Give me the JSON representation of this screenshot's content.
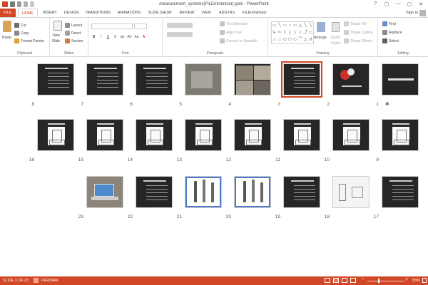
{
  "window": {
    "title": "measurement_systems(FILEminimizer).pptx - PowerPoint",
    "controls": [
      "?",
      "▢",
      "—",
      "▢",
      "✕"
    ]
  },
  "account": {
    "sign_in": "Sign in"
  },
  "tabs": [
    {
      "id": "file",
      "label": "FILE"
    },
    {
      "id": "home",
      "label": "HOME"
    },
    {
      "id": "insert",
      "label": "INSERT"
    },
    {
      "id": "design",
      "label": "DESIGN"
    },
    {
      "id": "transitions",
      "label": "TRANSITIONS"
    },
    {
      "id": "animations",
      "label": "ANIMATIONS"
    },
    {
      "id": "slideshow",
      "label": "SLIDE SHOW"
    },
    {
      "id": "review",
      "label": "REVIEW"
    },
    {
      "id": "view",
      "label": "VIEW"
    },
    {
      "id": "addins",
      "label": "ADD-INS"
    },
    {
      "id": "fileminimizer",
      "label": "FILEminimizer"
    }
  ],
  "ribbon": {
    "clipboard": {
      "label": "Clipboard",
      "paste": "Paste",
      "cut": "Cut",
      "copy": "Copy",
      "format_painter": "Format Painter"
    },
    "slides": {
      "label": "Slides",
      "new_slide": "New",
      "new_slide_2": "Slide",
      "layout": "Layout",
      "reset": "Reset",
      "section": "Section"
    },
    "font": {
      "label": "Font",
      "buttons": [
        "B",
        "I",
        "U",
        "S",
        "ab",
        "AV",
        "Aa",
        "A"
      ]
    },
    "paragraph": {
      "label": "Paragraph",
      "text_direction": "Text Direction",
      "align_text": "Align Text",
      "convert_smartart": "Convert to SmartArt"
    },
    "drawing": {
      "label": "Drawing",
      "arrange": "Arrange",
      "quick_styles": "Quick",
      "quick_styles_2": "Styles",
      "shape_fill": "Shape Fill",
      "shape_outline": "Shape Outline",
      "shape_effects": "Shape Effects"
    },
    "editing": {
      "label": "Editing",
      "find": "Find",
      "replace": "Replace",
      "select": "Select"
    }
  },
  "shapes": [
    "▭",
    "╲",
    "▭",
    "○",
    "▭",
    "△",
    "╲",
    "╲",
    "↳",
    "⇨",
    "⇧",
    "{",
    "}",
    "☆",
    "⤴",
    "▭",
    "▱",
    "⌂",
    "⬭",
    "⬠",
    "◇",
    "⌒",
    "△",
    "↺"
  ],
  "slides": [
    {
      "num": "1",
      "style": "title-dark"
    },
    {
      "num": "2",
      "style": "photo-flowers"
    },
    {
      "num": "3",
      "style": "text-dark",
      "selected": true
    },
    {
      "num": "4",
      "style": "photo-grid"
    },
    {
      "num": "5",
      "style": "photo-machine"
    },
    {
      "num": "6",
      "style": "text-dark"
    },
    {
      "num": "7",
      "style": "text-dark"
    },
    {
      "num": "8",
      "style": "text-dark"
    },
    {
      "num": "9",
      "style": "diagram"
    },
    {
      "num": "10",
      "style": "diagram"
    },
    {
      "num": "11",
      "style": "diagram"
    },
    {
      "num": "12",
      "style": "diagram"
    },
    {
      "num": "13",
      "style": "diagram"
    },
    {
      "num": "14",
      "style": "diagram"
    },
    {
      "num": "15",
      "style": "diagram"
    },
    {
      "num": "16",
      "style": "diagram"
    },
    {
      "num": "17",
      "style": "text-dark"
    },
    {
      "num": "18",
      "style": "white-sketch"
    },
    {
      "num": "19",
      "style": "text-dark"
    },
    {
      "num": "20",
      "style": "probes"
    },
    {
      "num": "21",
      "style": "probes"
    },
    {
      "num": "22",
      "style": "text-dark"
    },
    {
      "num": "23",
      "style": "photo-laptop"
    }
  ],
  "status": {
    "slide_info": "SLIDE 3 OF 23",
    "language": "PERSIAN",
    "zoom": "58%",
    "zoom_percent": 58
  },
  "colors": {
    "accent": "#d24726",
    "slide_dark": "#262626"
  }
}
